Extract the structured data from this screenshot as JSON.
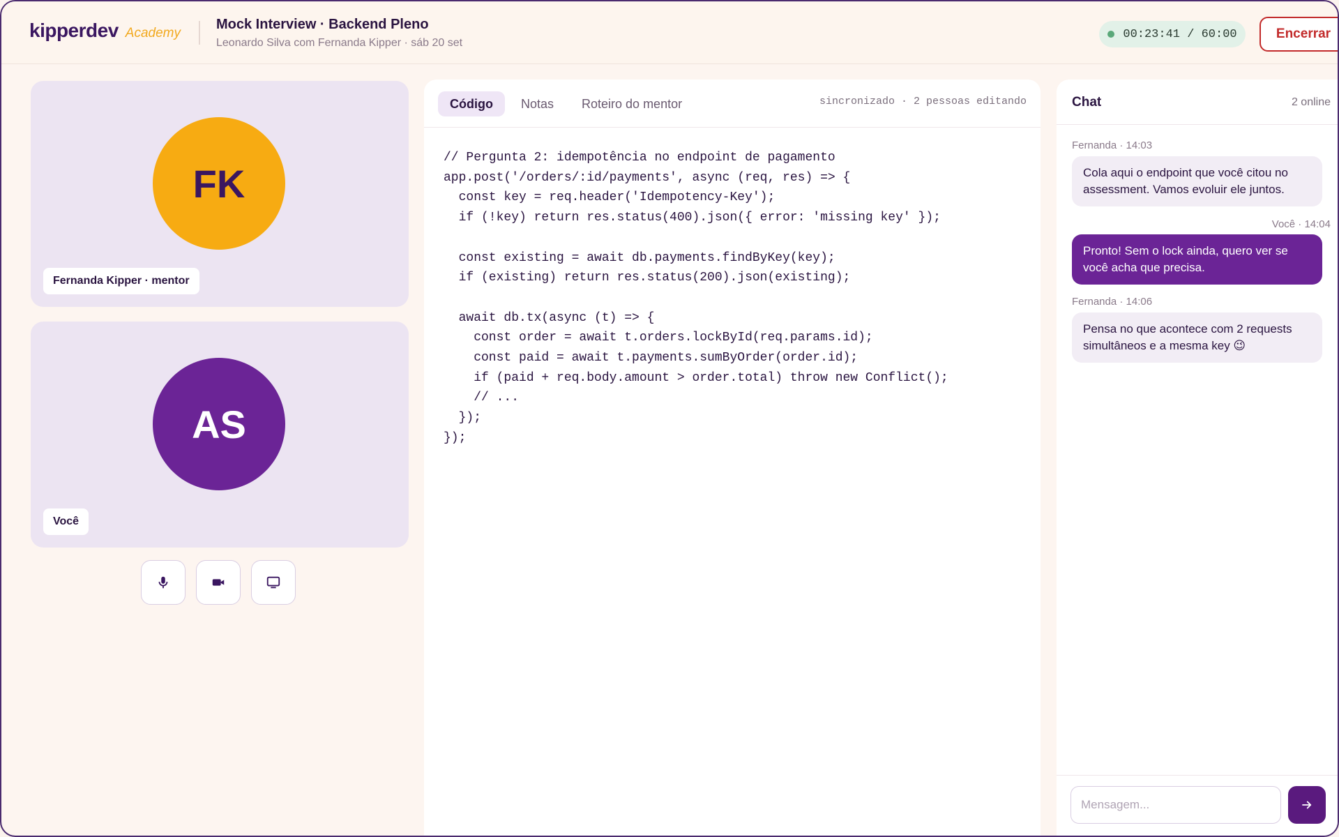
{
  "brand": {
    "name": "kipperdev",
    "sub": "Academy"
  },
  "session": {
    "title": "Mock Interview · Backend Pleno",
    "meta": "Leonardo Silva com Fernanda Kipper · sáb 20 set"
  },
  "timer": "00:23:41 / 60:00",
  "end_button": "Encerrar",
  "participants": [
    {
      "initials": "FK",
      "label": "Fernanda Kipper · mentor",
      "color": "#f7ab12"
    },
    {
      "initials": "AS",
      "label": "Você",
      "color": "#6b2496"
    }
  ],
  "controls": [
    {
      "icon": "microphone-icon"
    },
    {
      "icon": "video-camera-icon"
    },
    {
      "icon": "screen-share-icon"
    }
  ],
  "editor": {
    "tabs": [
      "Código",
      "Notas",
      "Roteiro do mentor"
    ],
    "active_tab": "Código",
    "sync_status": "sincronizado · 2 pessoas editando",
    "code_lines": [
      "// Pergunta 2: idempotência no endpoint de pagamento",
      "app.post('/orders/:id/payments', async (req, res) => {",
      "  const key = req.header('Idempotency-Key');",
      "  if (!key) return res.status(400).json({ error: 'missing key' });",
      "",
      "  const existing = await db.payments.findByKey(key);",
      "  if (existing) return res.status(200).json(existing);",
      "",
      "  await db.tx(async (t) => {",
      "    const order = await t.orders.lockById(req.params.id);",
      "    const paid = await t.payments.sumByOrder(order.id);",
      "    if (paid + req.body.amount > order.total) throw new Conflict();",
      "    // ...",
      "  });",
      "});"
    ]
  },
  "chat": {
    "title": "Chat",
    "online": "2 online",
    "messages": [
      {
        "meta": "Fernanda · 14:03",
        "text": "Cola aqui o endpoint que você citou no assessment. Vamos evoluir ele juntos.",
        "direction": "in"
      },
      {
        "meta": "Você · 14:04",
        "text": "Pronto! Sem o lock ainda, quero ver se você acha que precisa.",
        "direction": "out"
      },
      {
        "meta": "Fernanda · 14:06",
        "text": "Pensa no que acontece com 2 requests simultâneos e a mesma key 😉",
        "direction": "in"
      }
    ],
    "input_placeholder": "Mensagem..."
  }
}
